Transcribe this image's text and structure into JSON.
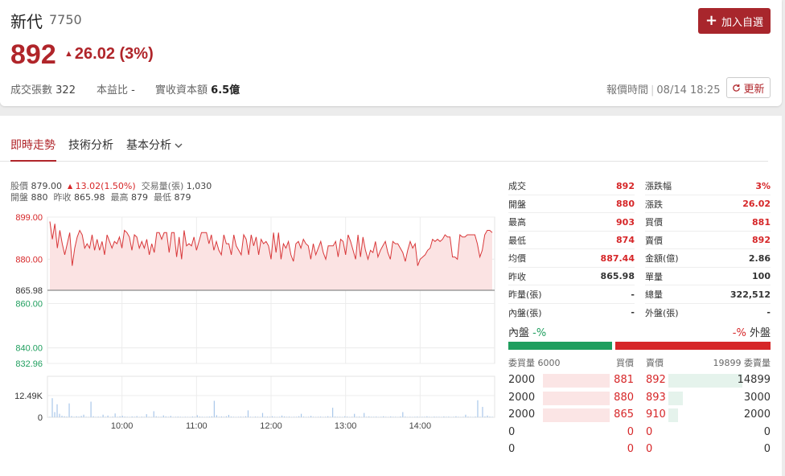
{
  "header": {
    "name": "新代",
    "code": "7750",
    "price": "892",
    "change": "26.02",
    "change_pct": "(3%)",
    "arrow": "▲",
    "meta": [
      {
        "label": "成交張數",
        "value": "322"
      },
      {
        "label": "本益比",
        "value": "-"
      },
      {
        "label": "實收資本額",
        "value": "6.5億"
      }
    ],
    "add_button": "加入自選",
    "quote_time_label": "報價時間",
    "quote_time": "08/14 18:25",
    "refresh_label": "更新"
  },
  "tabs": [
    {
      "label": "即時走勢",
      "active": true
    },
    {
      "label": "技術分析",
      "active": false
    },
    {
      "label": "基本分析",
      "active": false
    }
  ],
  "chart_info": {
    "line1": {
      "price_label": "股價",
      "price": "879.00",
      "change": "13.02(1.50%)",
      "volume_label": "交易量(張)",
      "volume": "1,030"
    },
    "line2": {
      "open_label": "開盤",
      "open": "880",
      "prev_label": "昨收",
      "prev": "865.98",
      "high_label": "最高",
      "high": "879",
      "low_label": "最低",
      "low": "879"
    }
  },
  "chart_data": {
    "type": "line",
    "price_y_ticks": [
      "899.00",
      "880.00",
      "865.98",
      "860.00",
      "840.00",
      "832.96"
    ],
    "volume_y_ticks": [
      "12.49K",
      "0"
    ],
    "x_ticks": [
      "10:00",
      "11:00",
      "12:00",
      "13:00",
      "14:00"
    ],
    "ylim": [
      832.96,
      899.0
    ],
    "reference": 865.98,
    "volume_max": 12490,
    "prices": [
      897,
      889,
      896,
      885,
      893,
      887,
      882,
      887,
      892,
      877,
      885,
      890,
      893,
      891,
      885,
      887,
      885,
      891,
      884,
      889,
      884,
      888,
      882,
      891,
      888,
      885,
      888,
      887,
      890,
      885,
      893,
      892,
      890,
      884,
      891,
      890,
      885,
      888,
      885,
      889,
      882,
      887,
      883,
      892,
      892,
      889,
      892,
      892,
      883,
      892,
      892,
      881,
      890,
      880,
      893,
      886,
      887,
      886,
      890,
      884,
      888,
      892,
      892,
      892,
      887,
      891,
      884,
      888,
      884,
      882,
      891,
      887,
      887,
      882,
      891,
      886,
      884,
      882,
      891,
      889,
      882,
      891,
      886,
      890,
      882,
      889,
      887,
      888,
      886,
      880,
      892,
      883,
      892,
      880,
      887,
      885,
      888,
      882,
      879,
      887,
      888,
      885,
      889,
      887,
      886,
      880,
      887,
      882,
      885,
      888,
      883,
      880,
      886,
      886,
      886,
      888,
      881,
      889,
      888,
      882,
      891,
      888,
      884,
      880,
      891,
      881,
      890,
      884,
      880,
      884,
      883,
      888,
      881,
      884,
      886,
      888,
      883,
      880,
      888,
      887,
      887,
      885,
      883,
      879,
      884,
      888,
      885,
      887,
      877,
      880,
      881,
      882,
      884,
      885,
      889,
      888,
      889,
      888,
      889,
      891,
      890,
      890,
      881,
      881,
      880,
      891,
      890,
      890,
      891,
      891,
      891,
      891,
      887,
      881,
      884,
      891,
      893,
      893,
      892
    ],
    "volumes": [
      300,
      11000,
      3000,
      7500,
      2000,
      900,
      600,
      400,
      8000,
      700,
      300,
      600,
      400,
      800,
      1500,
      300,
      200,
      9000,
      600,
      250,
      400,
      300,
      1500,
      300,
      1000,
      200,
      400,
      2200,
      300,
      600,
      900,
      400,
      300,
      200,
      500,
      300,
      700,
      200,
      400,
      300,
      1800,
      300,
      200,
      3500,
      600,
      300,
      300,
      1100,
      500,
      300,
      800,
      200,
      300,
      400,
      300,
      200,
      300,
      250,
      200,
      500,
      300,
      1200,
      400,
      300,
      200,
      300,
      400,
      600,
      9500,
      1200,
      300,
      500,
      300,
      600,
      1400,
      400,
      300,
      200,
      300,
      400,
      300,
      600,
      4000,
      300,
      200,
      400,
      300,
      200,
      2500,
      300,
      400,
      300,
      600,
      300,
      200,
      300,
      1000,
      500,
      300,
      400,
      200,
      300,
      300,
      600,
      2000,
      400,
      200,
      300,
      800,
      300,
      200,
      300,
      400,
      200,
      300,
      600,
      300,
      5500,
      400,
      300,
      300,
      200,
      600,
      400,
      200,
      300,
      2000,
      300,
      400,
      200,
      2500,
      300,
      500,
      300,
      300,
      400,
      200,
      300,
      600,
      300,
      200,
      500,
      300,
      300,
      200,
      500,
      3000,
      400,
      200,
      300,
      200,
      300,
      400,
      200,
      300,
      300,
      600,
      300,
      200,
      400,
      300,
      300,
      200,
      500,
      300,
      400,
      200,
      300,
      600,
      300,
      200,
      300,
      1500,
      400,
      300,
      200,
      400,
      9800,
      300,
      6000,
      500,
      1000,
      400,
      300
    ]
  },
  "stats_left": [
    {
      "label": "成交",
      "value": "892",
      "red": true
    },
    {
      "label": "開盤",
      "value": "880",
      "red": true
    },
    {
      "label": "最高",
      "value": "903",
      "red": true
    },
    {
      "label": "最低",
      "value": "874",
      "red": true
    },
    {
      "label": "均價",
      "value": "887.44",
      "red": true
    },
    {
      "label": "昨收",
      "value": "865.98",
      "red": false
    },
    {
      "label": "昨量(張)",
      "value": "-",
      "red": false
    },
    {
      "label": "內盤(張)",
      "value": "-",
      "red": false
    }
  ],
  "stats_right": [
    {
      "label": "漲跌幅",
      "value": "3%",
      "red": true
    },
    {
      "label": "漲跌",
      "value": "26.02",
      "red": true
    },
    {
      "label": "買價",
      "value": "881",
      "red": true
    },
    {
      "label": "賣價",
      "value": "892",
      "red": true
    },
    {
      "label": "金額(億)",
      "value": "2.86",
      "red": false
    },
    {
      "label": "單量",
      "value": "100",
      "red": false
    },
    {
      "label": "總量",
      "value": "322,512",
      "red": false
    },
    {
      "label": "外盤(張)",
      "value": "-",
      "red": false
    }
  ],
  "inout": {
    "in_label": "內盤",
    "in_pct": "-%",
    "out_pct": "-%",
    "out_label": "外盤",
    "in_share": 0.4,
    "green": "#1f9e5e",
    "red": "#d62628"
  },
  "orderbook": {
    "bid_vol_header": "委買量 6000",
    "bid_price_header": "買價",
    "ask_price_header": "賣價",
    "ask_vol_header": "19899 委賣量",
    "rows": [
      {
        "bid_vol": "2000",
        "bid": "881",
        "ask": "892",
        "ask_vol": "14899",
        "bid_frac": 0.333,
        "ask_frac": 0.749
      },
      {
        "bid_vol": "2000",
        "bid": "880",
        "ask": "893",
        "ask_vol": "3000",
        "bid_frac": 0.333,
        "ask_frac": 0.151
      },
      {
        "bid_vol": "2000",
        "bid": "865",
        "ask": "910",
        "ask_vol": "2000",
        "bid_frac": 0.333,
        "ask_frac": 0.1
      },
      {
        "bid_vol": "0",
        "bid": "0",
        "ask": "0",
        "ask_vol": "0",
        "bid_frac": 0,
        "ask_frac": 0
      },
      {
        "bid_vol": "0",
        "bid": "0",
        "ask": "0",
        "ask_vol": "0",
        "bid_frac": 0,
        "ask_frac": 0
      }
    ]
  },
  "colors": {
    "brand": "#a8262c",
    "up": "#d62628",
    "down": "#1f9e5e",
    "price_line": "#d9383a",
    "price_fill": "#fbe3e3",
    "volume_bar": "#a9c7ea"
  }
}
